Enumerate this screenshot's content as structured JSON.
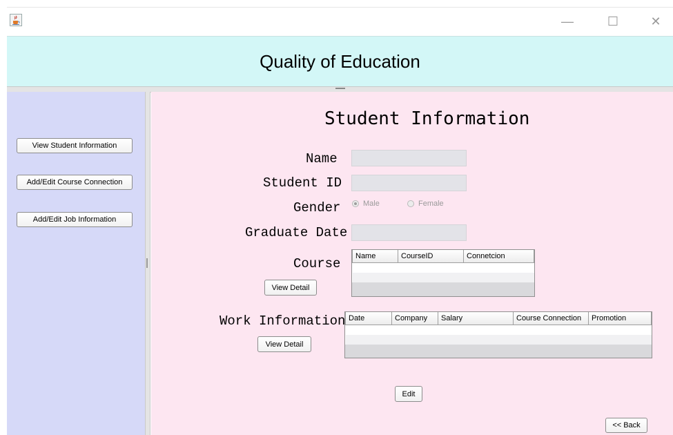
{
  "window": {
    "minimize_glyph": "—",
    "maximize_glyph": "☐",
    "close_glyph": "✕",
    "app_icon": "java-cup-icon"
  },
  "header": {
    "title": "Quality of Education"
  },
  "sidebar": {
    "buttons": [
      {
        "label": "View Student Information"
      },
      {
        "label": "Add/Edit Course Connection"
      },
      {
        "label": "Add/Edit Job Information"
      }
    ]
  },
  "main": {
    "title": "Student Information",
    "labels": {
      "name": "Name",
      "student_id": "Student ID",
      "gender": "Gender",
      "graduate_date": "Graduate Date",
      "course": "Course",
      "work_information": "Work Information"
    },
    "fields": {
      "name": "",
      "student_id": "",
      "graduate_date": ""
    },
    "gender_options": [
      {
        "label": "Male",
        "selected": true
      },
      {
        "label": "Female",
        "selected": false
      }
    ],
    "course_table": {
      "columns": [
        "Name",
        "CourseID",
        "Connetcion"
      ],
      "rows": []
    },
    "work_table": {
      "columns": [
        "Date",
        "Company",
        "Salary",
        "Course Connection",
        "Promotion"
      ],
      "rows": []
    },
    "course_view_detail": "View Detail",
    "work_view_detail": "View Detail",
    "edit_label": "Edit",
    "back_label": "<< Back"
  }
}
